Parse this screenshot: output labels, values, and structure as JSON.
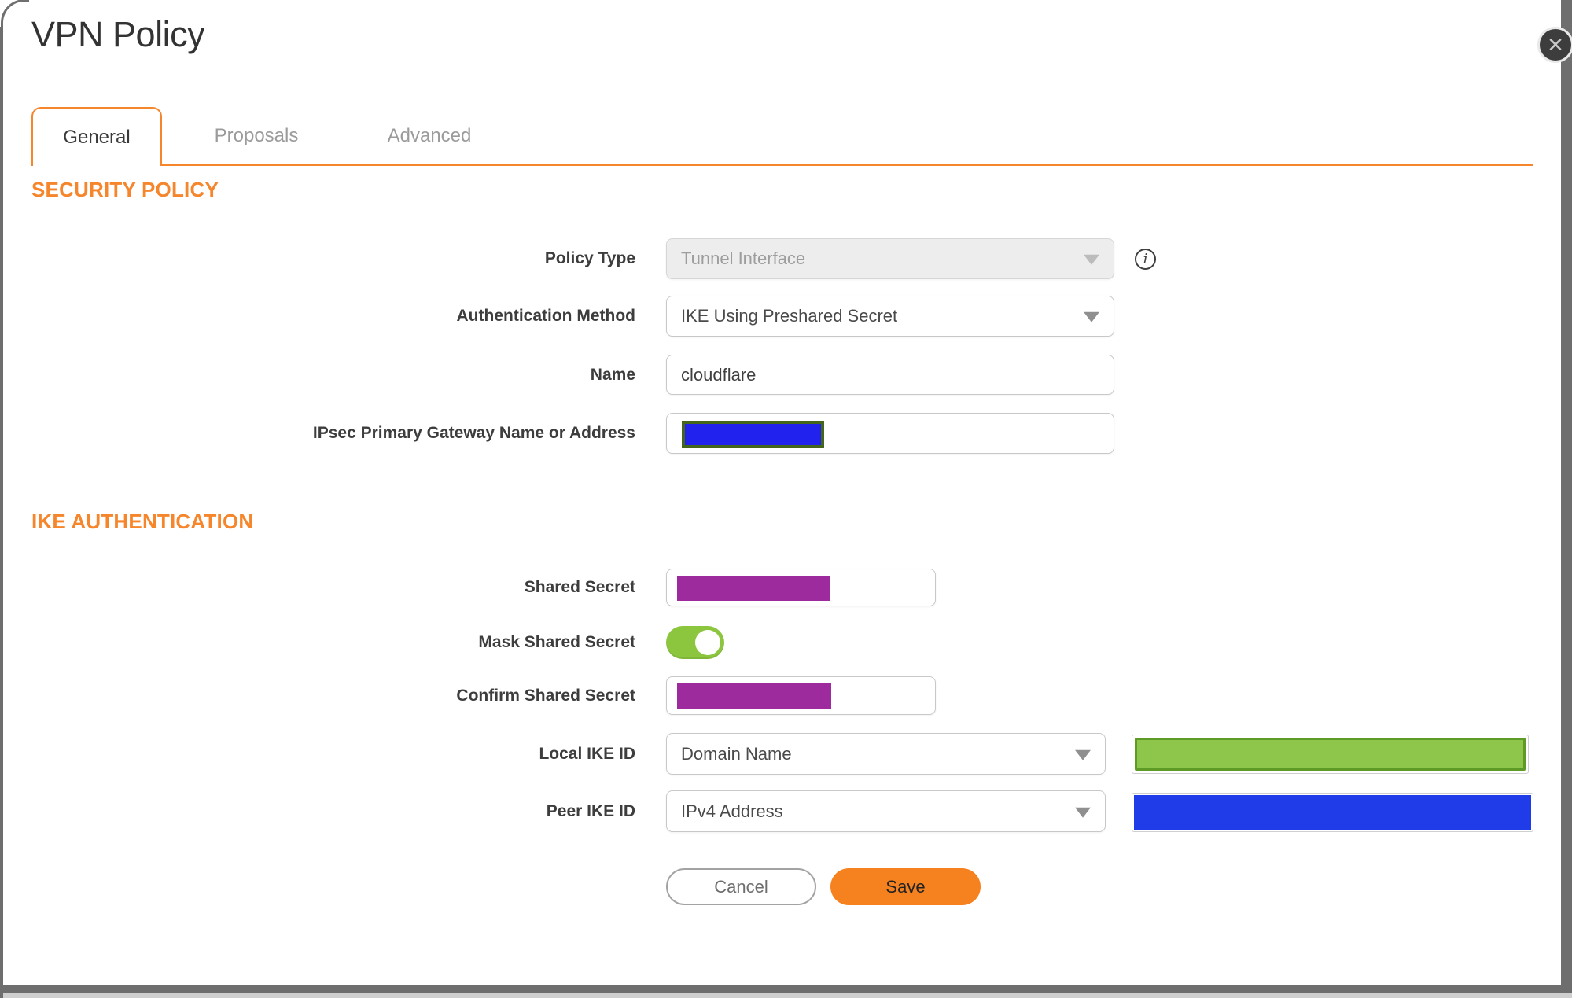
{
  "window": {
    "title": "VPN Policy",
    "close_icon": "close-icon",
    "close_glyph": "✕"
  },
  "tabs": {
    "items": [
      {
        "label": "General",
        "active": true
      },
      {
        "label": "Proposals",
        "active": false
      },
      {
        "label": "Advanced",
        "active": false
      }
    ]
  },
  "security_policy": {
    "heading": "SECURITY POLICY",
    "policy_type": {
      "label": "Policy Type",
      "value": "Tunnel Interface",
      "disabled": true,
      "info_icon": "info-icon",
      "info_glyph": "i"
    },
    "authentication_method": {
      "label": "Authentication Method",
      "value": "IKE Using Preshared Secret"
    },
    "name": {
      "label": "Name",
      "value": "cloudflare"
    },
    "gateway": {
      "label": "IPsec Primary Gateway Name or Address",
      "value": "",
      "redacted": true
    }
  },
  "ike_authentication": {
    "heading": "IKE AUTHENTICATION",
    "shared_secret": {
      "label": "Shared Secret",
      "value": "",
      "redacted": true
    },
    "mask_shared_secret": {
      "label": "Mask Shared Secret",
      "toggled": true
    },
    "confirm_shared_secret": {
      "label": "Confirm Shared Secret",
      "value": "",
      "redacted": true
    },
    "local_ike_id": {
      "label": "Local IKE ID",
      "value": "Domain Name",
      "field_redacted": true
    },
    "peer_ike_id": {
      "label": "Peer IKE ID",
      "value": "IPv4 Address",
      "field_redacted": true
    }
  },
  "actions": {
    "cancel_label": "Cancel",
    "save_label": "Save"
  },
  "colors": {
    "accent_orange": "#f6862c",
    "save_button_orange": "#f6821f",
    "toggle_green": "#8cc63f",
    "redaction_purple": "#9e2b9e",
    "redaction_blue": "#1f3ce8",
    "gateway_redaction_blue": "#2222ee",
    "gateway_redaction_border_green": "#44661c",
    "local_id_redaction_green_fill": "#8dc64a",
    "local_id_redaction_green_border": "#5d9b26",
    "backdrop_gray": "#6e6e6e"
  }
}
